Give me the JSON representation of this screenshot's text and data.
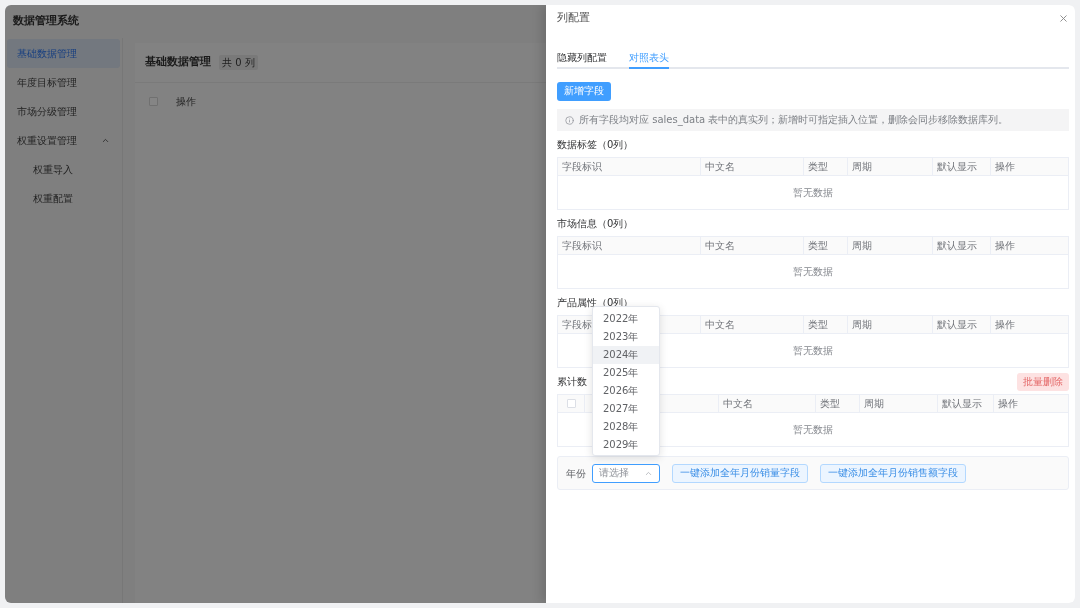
{
  "app": {
    "title": "数据管理系统"
  },
  "sidebar": {
    "items": [
      {
        "label": "基础数据管理",
        "selected": true
      },
      {
        "label": "年度目标管理",
        "selected": false
      },
      {
        "label": "市场分级管理",
        "selected": false
      },
      {
        "label": "权重设置管理",
        "selected": false,
        "expanded": true,
        "children": [
          {
            "label": "权重导入",
            "selected": false
          },
          {
            "label": "权重配置",
            "selected": false
          }
        ]
      }
    ]
  },
  "main": {
    "title": "基础数据管理",
    "count": "共 0 列",
    "table": {
      "checked": false,
      "columns": [
        "操作"
      ]
    }
  },
  "drawer": {
    "title": "列配置",
    "tabs": [
      {
        "label": "隐藏列配置",
        "selected": false
      },
      {
        "label": "对照表头",
        "selected": true
      }
    ],
    "add_button": "新增字段",
    "notice": "所有字段均对应 sales_data 表中的真实列；新增时可指定插入位置，删除会同步移除数据库列。",
    "sections": [
      {
        "kind": "plain",
        "title": "数据标签（0列）",
        "columns": [
          "字段标识",
          "中文名",
          "类型",
          "周期",
          "默认显示",
          "操作"
        ],
        "empty_text": "暂无数据"
      },
      {
        "kind": "plain",
        "title": "市场信息（0列）",
        "columns": [
          "字段标识",
          "中文名",
          "类型",
          "周期",
          "默认显示",
          "操作"
        ],
        "empty_text": "暂无数据"
      },
      {
        "kind": "plain",
        "title": "产品属性（0列）",
        "columns": [
          "字段标",
          "中文名",
          "类型",
          "周期",
          "默认显示",
          "操作"
        ],
        "empty_text": "暂无数据"
      },
      {
        "kind": "selectable",
        "title": "累计数",
        "checked": false,
        "batch_button": {
          "label": "批量删除",
          "disabled": true
        },
        "columns": [
          "中文名",
          "类型",
          "周期",
          "默认显示",
          "操作"
        ],
        "empty_text": "暂无数据"
      }
    ],
    "year_bar": {
      "label": "年份",
      "select": {
        "placeholder": "请选择",
        "expanded": true,
        "options": [
          {
            "label": "2022年",
            "hovered": false
          },
          {
            "label": "2023年",
            "hovered": false
          },
          {
            "label": "2024年",
            "hovered": true
          },
          {
            "label": "2025年",
            "hovered": false
          },
          {
            "label": "2026年",
            "hovered": false
          },
          {
            "label": "2027年",
            "hovered": false
          },
          {
            "label": "2028年",
            "hovered": false
          },
          {
            "label": "2029年",
            "hovered": false
          }
        ]
      },
      "buttons": [
        "一键添加全年月份销量字段",
        "一键添加全年月份销售额字段"
      ]
    }
  }
}
